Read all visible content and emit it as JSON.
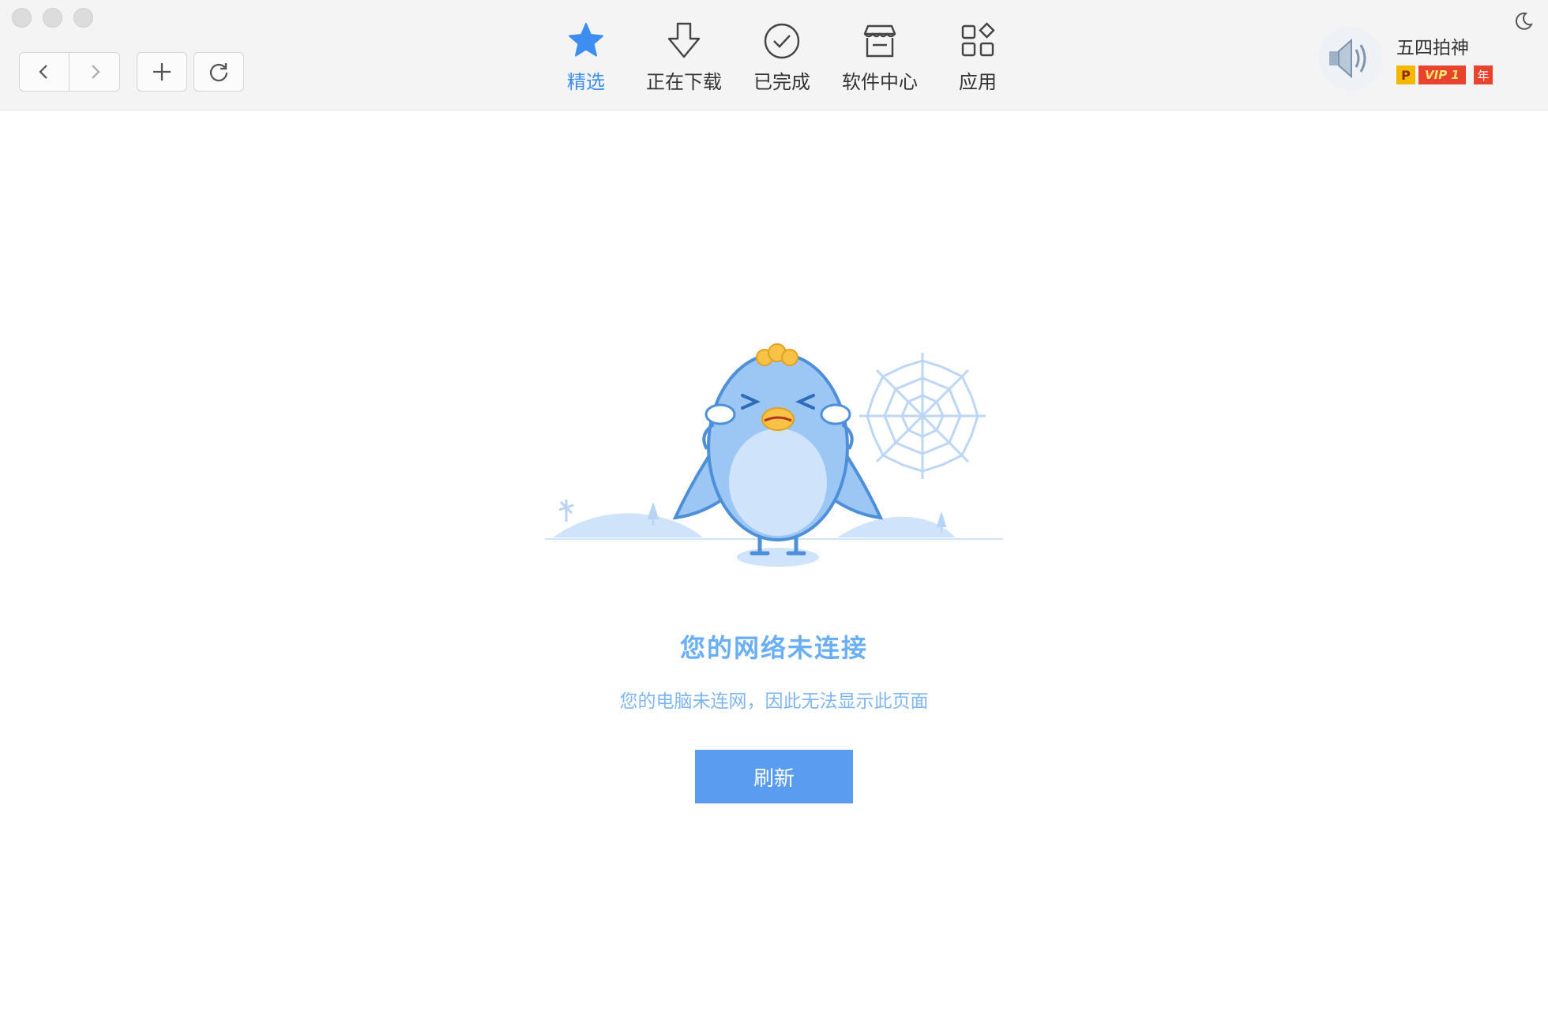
{
  "toolbar": {
    "back_icon": "chevron-left-icon",
    "forward_icon": "chevron-right-icon",
    "new_tab_icon": "plus-icon",
    "reload_icon": "reload-icon"
  },
  "tabs": [
    {
      "label": "精选",
      "icon": "star-icon",
      "active": true
    },
    {
      "label": "正在下载",
      "icon": "download-arrow-icon",
      "active": false
    },
    {
      "label": "已完成",
      "icon": "check-circle-icon",
      "active": false
    },
    {
      "label": "软件中心",
      "icon": "store-icon",
      "active": false
    },
    {
      "label": "应用",
      "icon": "apps-grid-icon",
      "active": false
    }
  ],
  "user": {
    "name": "五四拍神",
    "badge_p": "P",
    "badge_vip": "VIP 1",
    "badge_year": "年"
  },
  "error": {
    "title": "您的网络未连接",
    "description": "您的电脑未连网，因此无法显示此页面",
    "refresh_label": "刷新"
  },
  "colors": {
    "accent": "#3d8ef0",
    "button": "#5a9cf0",
    "error_text": "#6aaef5"
  }
}
